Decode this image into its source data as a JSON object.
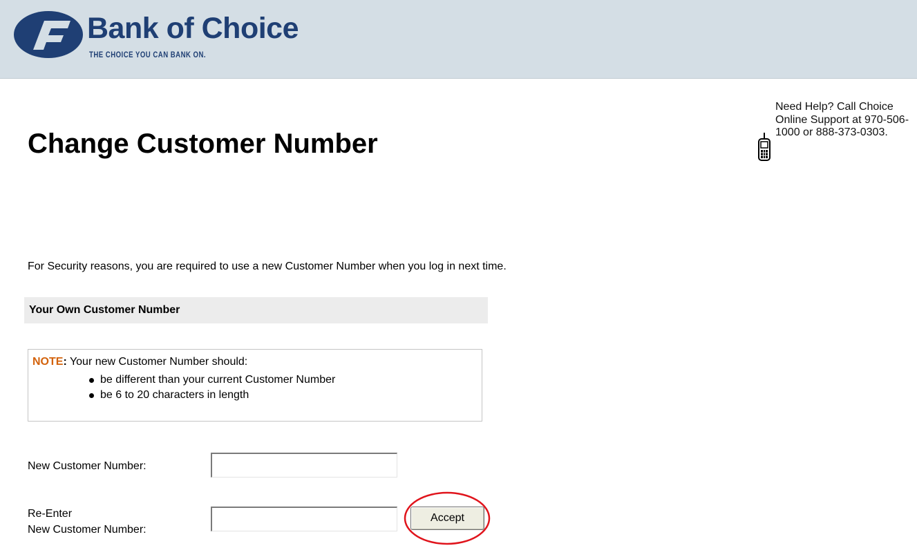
{
  "header": {
    "brand_name": "Bank of Choice",
    "tagline": "THE CHOICE YOU CAN BANK ON.",
    "brand_color": "#1f3f74",
    "background_color": "#d4dee5"
  },
  "page": {
    "title": "Change Customer Number"
  },
  "help": {
    "icon": "mobile-phone-icon",
    "text": "Need Help? Call Choice Online Support at 970-506-1000 or 888-373-0303."
  },
  "intro_text": "For Security reasons, you are required to use a new Customer Number when you log in next time.",
  "section": {
    "title": "Your Own Customer Number"
  },
  "note": {
    "label": "NOTE",
    "label_color": "#d3620b",
    "lead": "Your new Customer Number should:",
    "items": [
      "be different than your current Customer Number",
      "be 6 to 20 characters in length"
    ]
  },
  "form": {
    "new_number_label": "New Customer Number:",
    "new_number_value": "",
    "reenter_label_line1": "Re-Enter",
    "reenter_label_line2": "New Customer Number:",
    "reenter_value": "",
    "accept_label": "Accept"
  },
  "annotation": {
    "highlight_color": "#e0141c"
  }
}
